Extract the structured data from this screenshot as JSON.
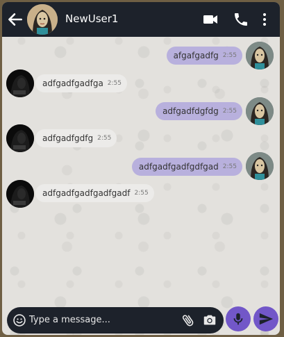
{
  "header": {
    "contact_name": "NewUser1",
    "icons": [
      "back-arrow-icon",
      "video-call-icon",
      "phone-call-icon",
      "more-options-icon"
    ]
  },
  "messages": [
    {
      "direction": "outgoing",
      "text": "afgafgadfg",
      "time": "2:55"
    },
    {
      "direction": "incoming",
      "text": "adfgadfgadfga",
      "time": "2:55"
    },
    {
      "direction": "outgoing",
      "text": "adfgadfdgfdg",
      "time": "2:55"
    },
    {
      "direction": "incoming",
      "text": "adfgadfgdfg",
      "time": "2:55"
    },
    {
      "direction": "outgoing",
      "text": "adfgadfgadfgdfgad",
      "time": "2:55"
    },
    {
      "direction": "incoming",
      "text": "adfgadfgadfgadfgadf",
      "time": "2:55"
    }
  ],
  "composer": {
    "placeholder": "Type a message...",
    "icons": [
      "emoji-icon",
      "paperclip-icon",
      "camera-icon",
      "microphone-icon",
      "send-icon"
    ]
  },
  "colors": {
    "header_bg": "#1d222b",
    "outgoing_bubble": "#b8b0dd",
    "incoming_bubble": "#ecebe9",
    "accent": "#7257c8"
  }
}
